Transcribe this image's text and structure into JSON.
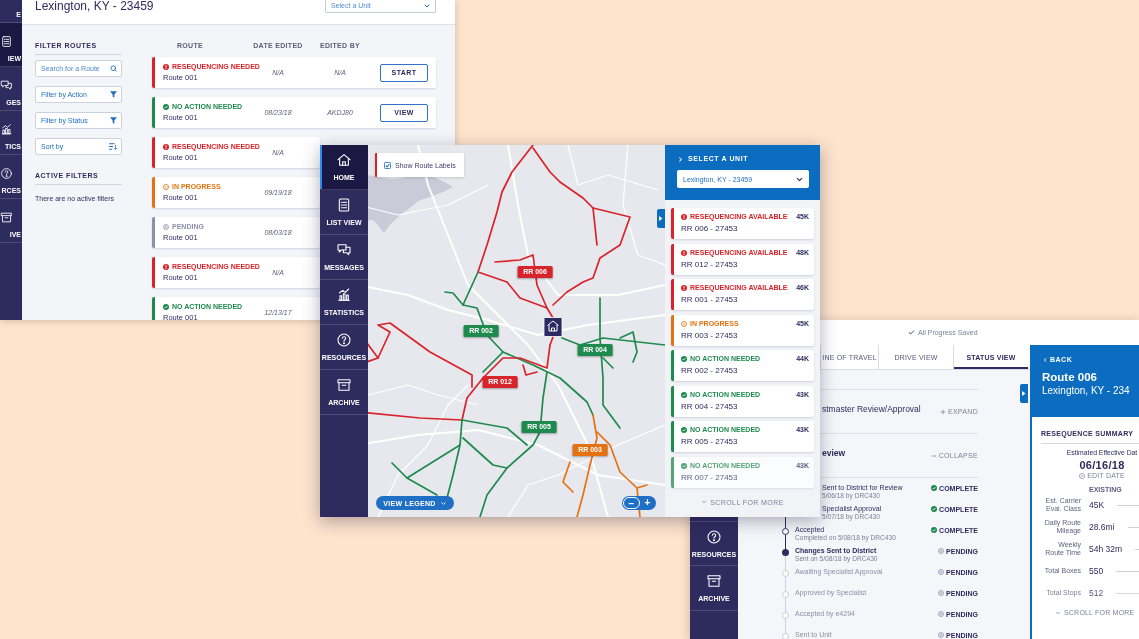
{
  "list_window": {
    "nav": [
      {
        "label": "E",
        "selected": false
      },
      {
        "label": "IEW",
        "selected": true
      },
      {
        "label": "GES",
        "selected": false
      },
      {
        "label": "TICS",
        "selected": false
      },
      {
        "label": "RCES",
        "selected": false
      },
      {
        "label": "IVE",
        "selected": false
      }
    ],
    "title": "Lexington, KY - 23459",
    "unit_select": {
      "placeholder": "Select a Unit"
    },
    "filters": {
      "heading": "FILTER ROUTES",
      "search": {
        "placeholder": "Search for a Route"
      },
      "controls": [
        {
          "label": "Filter by Action",
          "kind": "filter"
        },
        {
          "label": "Filter by Status",
          "kind": "filter"
        },
        {
          "label": "Sort by",
          "kind": "sort"
        }
      ]
    },
    "active_filters": {
      "heading": "ACTIVE FILTERS",
      "message": "There are no active filters"
    },
    "table": {
      "columns": [
        "ROUTE",
        "DATE EDITED",
        "EDITED BY"
      ],
      "rows": [
        {
          "status": "RESEQUENCING NEEDED",
          "kind": "alert",
          "route": "Route 001",
          "date": "N/A",
          "editor": "N/A",
          "action": "START"
        },
        {
          "status": "NO ACTION NEEDED",
          "kind": "ok",
          "route": "Route 001",
          "date": "08/23/18",
          "editor": "AKDJ80",
          "action": "VIEW"
        },
        {
          "status": "RESEQUENCING NEEDED",
          "kind": "alert",
          "route": "Route 001",
          "date": "N/A"
        },
        {
          "status": "IN PROGRESS",
          "kind": "progress",
          "route": "Route 001",
          "date": "09/19/18"
        },
        {
          "status": "PENDING",
          "kind": "pending",
          "route": "Route 001",
          "date": "08/03/18"
        },
        {
          "status": "RESEQUENCING NEEDED",
          "kind": "alert",
          "route": "Route 001",
          "date": "N/A"
        },
        {
          "status": "NO ACTION NEEDED",
          "kind": "ok",
          "route": "Route 001",
          "date": "12/13/17"
        }
      ]
    }
  },
  "map_window": {
    "nav": [
      {
        "label": "HOME",
        "selected": true
      },
      {
        "label": "LIST VIEW",
        "selected": false
      },
      {
        "label": "MESSAGES",
        "selected": false
      },
      {
        "label": "STATISTICS",
        "selected": false
      },
      {
        "label": "RESOURCES",
        "selected": false
      },
      {
        "label": "ARCHIVE",
        "selected": false
      }
    ],
    "route_labels": {
      "label": "Show Route Labels",
      "checked": true
    },
    "routes": [
      {
        "label": "RR 006",
        "kind": "alert"
      },
      {
        "label": "RR 002",
        "kind": "ok"
      },
      {
        "label": "RR 004",
        "kind": "ok"
      },
      {
        "label": "RR 012",
        "kind": "alert"
      },
      {
        "label": "RR 005",
        "kind": "ok"
      },
      {
        "label": "RR 003",
        "kind": "progress"
      }
    ],
    "legend_button": "VIEW LEGEND",
    "zoom": {
      "out": "−",
      "in": "+"
    },
    "panel": {
      "heading": "SELECT A UNIT",
      "unit": {
        "value": "Lexington, KY - 23459"
      },
      "routes": [
        {
          "status": "RESEQUENCING AVAILABLE",
          "kind": "alert",
          "route": "RR 006 - 27453",
          "size": "45K"
        },
        {
          "status": "RESEQUENCING AVAILABLE",
          "kind": "alert",
          "route": "RR 012 - 27453",
          "size": "48K"
        },
        {
          "status": "RESEQUENCING AVAILABLE",
          "kind": "alert",
          "route": "RR 001 - 27453",
          "size": "46K"
        },
        {
          "status": "IN PROGRESS",
          "kind": "progress",
          "route": "RR 003 - 27453",
          "size": "45K"
        },
        {
          "status": "NO ACTION NEEDED",
          "kind": "ok",
          "route": "RR 002 - 27453",
          "size": "44K"
        },
        {
          "status": "NO ACTION NEEDED",
          "kind": "ok",
          "route": "RR 004 - 27453",
          "size": "43K"
        },
        {
          "status": "NO ACTION NEEDED",
          "kind": "ok",
          "route": "RR 005 - 27453",
          "size": "43K"
        },
        {
          "status": "NO ACTION NEEDED",
          "kind": "ok",
          "route": "RR 007 - 27453",
          "size": "43K"
        }
      ],
      "scroll_hint": "SCROLL FOR MORE"
    }
  },
  "status_window": {
    "saved": "All Progress Saved",
    "nav": [
      {
        "label": "RESOURCES",
        "selected": false
      },
      {
        "label": "ARCHIVE",
        "selected": false
      }
    ],
    "tabs": [
      {
        "label": "INE OF TRAVEL",
        "selected": false
      },
      {
        "label": "DRIVE VIEW",
        "selected": false
      },
      {
        "label": "STATUS VIEW",
        "selected": true
      }
    ],
    "sections": [
      {
        "title": "stmaster Review/Approval",
        "action": "EXPAND",
        "expanded": false
      },
      {
        "title": "eview",
        "action": "COLLAPSE",
        "expanded": true
      }
    ],
    "steps": [
      {
        "title": "Sent to District for Review",
        "note": "5/06/18 by DRC430",
        "status": "COMPLETE",
        "kind": "done"
      },
      {
        "title": "Specialist Approval",
        "note": "5/07/18 by DRC430",
        "status": "COMPLETE",
        "kind": "done"
      },
      {
        "title": "Accepted",
        "note": "Completed on 5/08/18 by DRC430",
        "status": "COMPLETE",
        "kind": "done"
      },
      {
        "title": "Changes Sent to District",
        "note": "Sent on 5/08/18 by DRC430",
        "status": "PENDING",
        "kind": "current"
      },
      {
        "title": "Awaiting Specialist Approval",
        "status": "PENDING",
        "kind": "upcoming"
      },
      {
        "title": "Approved by Specialist",
        "status": "PENDING",
        "kind": "upcoming"
      },
      {
        "title": "Accepted by e4294",
        "status": "PENDING",
        "kind": "upcoming"
      },
      {
        "title": "Sent to Unit",
        "status": "PENDING",
        "kind": "upcoming"
      }
    ],
    "summary": {
      "back": "BACK",
      "route": "Route 006",
      "unit": "Lexington, KY - 234",
      "heading": "RESEQUENCE SUMMARY",
      "date_label": "Estimated Effective Dat",
      "date": "06/16/18",
      "edit": "EDIT DATE",
      "column": "EXISTING",
      "rows": [
        {
          "label": "Est. Carrier Eval. Class",
          "value": "45K"
        },
        {
          "label": "Daily Route Mileage",
          "value": "28.6mi"
        },
        {
          "label": "Weekly Route Time",
          "value": "54h 32m"
        },
        {
          "label": "Total Boxes",
          "value": "550"
        },
        {
          "label": "Total Stops",
          "value": "512"
        }
      ],
      "scroll_hint": "SCROLL FOR MORE"
    }
  }
}
